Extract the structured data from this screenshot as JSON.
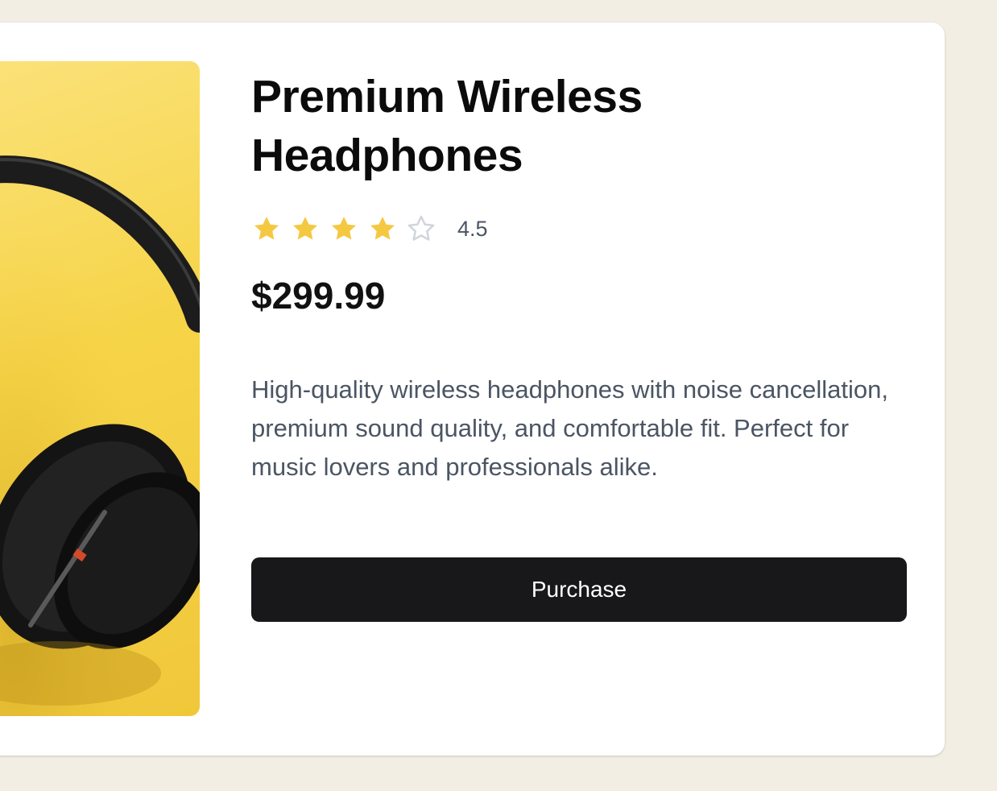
{
  "product": {
    "title": "Premium Wireless Headphones",
    "rating": 4.5,
    "rating_display": "4.5",
    "stars_filled": 4,
    "stars_total": 5,
    "price": "$299.99",
    "description": "High-quality wireless headphones with noise cancellation, premium sound quality, and comfortable fit. Perfect for music lovers and professionals alike.",
    "purchase_label": "Purchase",
    "image_subject": "black headphones on yellow background"
  },
  "colors": {
    "page_background": "#f2eee4",
    "card_background": "#ffffff",
    "star_filled": "#f5c842",
    "star_empty": "#d1d5db",
    "button_background": "#18181b",
    "button_text": "#ffffff",
    "description_text": "#4b5563"
  },
  "icons": {
    "star_filled": "star-filled-icon",
    "star_empty": "star-empty-icon"
  }
}
